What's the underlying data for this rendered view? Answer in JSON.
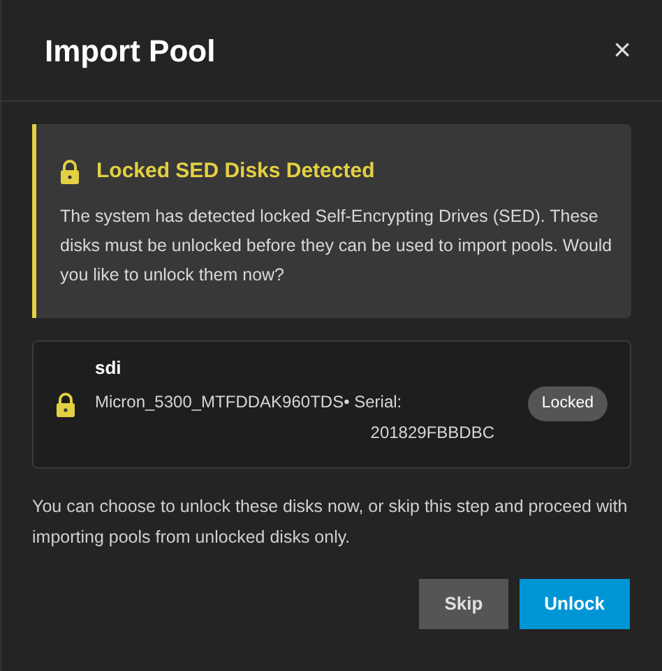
{
  "dialog": {
    "title": "Import Pool",
    "close": "×"
  },
  "alert": {
    "title": "Locked SED Disks Detected",
    "message": "The system has detected locked Self-Encrypting Drives (SED). These disks must be unlocked before they can be used to import pools. Would you like to unlock them now?"
  },
  "disks": [
    {
      "name": "sdi",
      "model": "Micron_5300_MTFDDAK960TDS",
      "separator": "•",
      "serial_label": "Serial:",
      "serial": "201829FBBDBC",
      "status": "Locked",
      "locked": true
    }
  ],
  "note": "You can choose to unlock these disks now, or skip this step and proceed with importing pools from unlocked disks only.",
  "buttons": [
    {
      "label": "Skip",
      "kind": "secondary"
    },
    {
      "label": "Unlock",
      "kind": "primary"
    }
  ]
}
